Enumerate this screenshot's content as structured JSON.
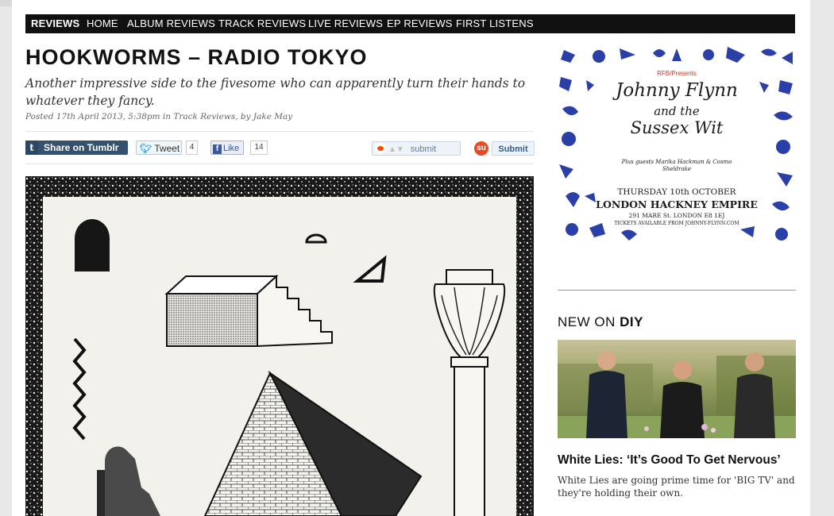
{
  "nav": {
    "items": [
      "REVIEWS",
      "HOME",
      "ALBUM REVIEWS",
      "TRACK REVIEWS",
      "LIVE REVIEWS",
      "EP REVIEWS",
      "FIRST LISTENS"
    ],
    "active": "REVIEWS"
  },
  "article": {
    "title": "HOOKWORMS – RADIO TOKYO",
    "standfirst": "Another impressive side to the fivesome who can apparently turn their hands to whatever they fancy.",
    "posted": "Posted 17th April 2013, 5:38pm in Track Reviews, by Jake May"
  },
  "share": {
    "tumblr_icon": "t",
    "tumblr_label": "Share on Tumblr",
    "tweet_label": "Tweet",
    "tweet_count": "4",
    "like_icon": "f",
    "like_label": "Like",
    "like_count": "14",
    "reddit_label": "submit",
    "stumble_label": "Submit"
  },
  "ad": {
    "presents": "RFB/Presents",
    "artist_line1": "Johnny Flynn",
    "artist_line2": "and the",
    "artist_line3": "Sussex Wit",
    "support": "Plus guests Marika Hackman & Cosmo Sheldrake",
    "date": "THURSDAY 10th OCTOBER",
    "venue": "LONDON HACKNEY EMPIRE",
    "address": "291 MARE St. LONDON E8 1EJ",
    "tickets": "TICKETS AVAILABLE FROM JOHNNY-FLYNN.COM"
  },
  "sidebar": {
    "section_prefix": "NEW ON",
    "section_brand": "DIY",
    "story_title": "White Lies: ‘It’s Good To Get Nervous’",
    "story_desc": "White Lies are going prime time for 'BIG TV' and they're holding their own."
  },
  "colors": {
    "nav_bg": "#111111",
    "tumblr": "#34526f",
    "twitter": "#2aa3ef",
    "facebook": "#3b5998",
    "stumbleupon": "#eb4924",
    "ad_ink": "#2a3fa8"
  }
}
